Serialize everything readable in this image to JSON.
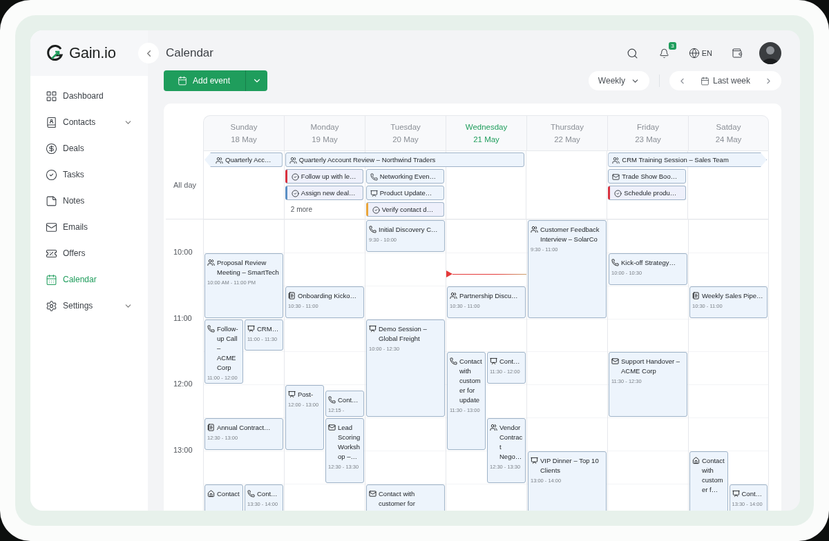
{
  "brand": {
    "name": "Gain.io"
  },
  "sidebar": {
    "items": [
      {
        "label": "Dashboard",
        "selected": false,
        "has_submenu": false
      },
      {
        "label": "Contacts",
        "selected": false,
        "has_submenu": true
      },
      {
        "label": "Deals",
        "selected": false,
        "has_submenu": false
      },
      {
        "label": "Tasks",
        "selected": false,
        "has_submenu": false
      },
      {
        "label": "Notes",
        "selected": false,
        "has_submenu": false
      },
      {
        "label": "Emails",
        "selected": false,
        "has_submenu": false
      },
      {
        "label": "Offers",
        "selected": false,
        "has_submenu": false
      },
      {
        "label": "Calendar",
        "selected": true,
        "has_submenu": false
      },
      {
        "label": "Settings",
        "selected": false,
        "has_submenu": true
      }
    ]
  },
  "header": {
    "title": "Calendar",
    "notifications": "3",
    "language": "EN"
  },
  "toolbar": {
    "add_button": "Add event",
    "view": "Weekly",
    "range": "Last week"
  },
  "calendar": {
    "all_day_label": "All day",
    "hours": [
      "10:00",
      "11:00",
      "12:00",
      "13:00"
    ],
    "days": [
      {
        "name": "Sunday",
        "date": "18 May",
        "selected": false,
        "events": [
          {
            "kind": "meeting",
            "title": "Proposal Review Meeting – SmartTech",
            "time": "10:00 AM - 11:00 PM"
          },
          {
            "kind": "call",
            "title": "Follow-up Call – ACME Corp",
            "time": "11:00 - 12:00"
          },
          {
            "kind": "presentation",
            "title": "CRM…",
            "time": "11:00 - 11:30"
          },
          {
            "kind": "note",
            "title": "Annual Contract…",
            "time": "12:30 - 13:00"
          },
          {
            "kind": "visit",
            "title": "Contact"
          },
          {
            "kind": "call",
            "title": "Cont…",
            "time": "13:30 - 14:00"
          }
        ]
      },
      {
        "name": "Monday",
        "date": "19 May",
        "selected": false,
        "events": [
          {
            "kind": "note",
            "title": "Onboarding Kicko…",
            "time": "10:30 - 11:00"
          },
          {
            "kind": "presentation",
            "title": "Post-",
            "time": "12:00 - 13:00"
          },
          {
            "kind": "call",
            "title": "Cont…",
            "time": "12:15 -"
          },
          {
            "kind": "email",
            "title": "Lead Scoring Workshop –…",
            "time": "12:30 - 13:30"
          }
        ]
      },
      {
        "name": "Tuesday",
        "date": "20 May",
        "selected": false,
        "events": [
          {
            "kind": "call",
            "title": "Initial Discovery C…",
            "time": "9:30 - 10:00"
          },
          {
            "kind": "presentation",
            "title": "Demo Session – Global Freight",
            "time": "10:00 - 12:30"
          },
          {
            "kind": "email",
            "title": "Contact with customer for"
          }
        ]
      },
      {
        "name": "Wednesday",
        "date": "21 May",
        "selected": true,
        "events": [
          {
            "kind": "meeting",
            "title": "Partnership Discu…",
            "time": "10:30 - 11:00"
          },
          {
            "kind": "call",
            "title": "Contact with customer for update",
            "time": "11:30 - 13:00"
          },
          {
            "kind": "presentation",
            "title": "Cont…",
            "time": "11:30 - 12:00"
          },
          {
            "kind": "meeting",
            "title": "Vendor Contract Nego…",
            "time": "12:30 - 13:30"
          }
        ]
      },
      {
        "name": "Thursday",
        "date": "22 May",
        "selected": false,
        "events": [
          {
            "kind": "meeting",
            "title": "Customer Feedback Interview – SolarCo",
            "time": "9:30 - 11:00"
          },
          {
            "kind": "presentation",
            "title": "VIP Dinner – Top 10 Clients",
            "time": "13:00 - 14:00"
          }
        ]
      },
      {
        "name": "Friday",
        "date": "23 May",
        "selected": false,
        "events": [
          {
            "kind": "call",
            "title": "Kick-off Strategy…",
            "time": "10:00 - 10:30"
          },
          {
            "kind": "email",
            "title": "Support Handover – ACME Corp",
            "time": "11:30 - 12:30"
          }
        ]
      },
      {
        "name": "Satday",
        "date": "24 May",
        "selected": false,
        "events": [
          {
            "kind": "note",
            "title": "Weekly Sales Pipe…",
            "time": "10:30 - 11:00"
          },
          {
            "kind": "visit",
            "title": "Contact with customer f…"
          },
          {
            "kind": "presentation",
            "title": "Cont…",
            "time": "13:30 - 14:00"
          }
        ]
      }
    ],
    "all_day": [
      {
        "kind": "meeting",
        "title": "Quarterly Acc…",
        "continues_before": true
      },
      {
        "kind": "meeting",
        "title": "Quarterly Account Review – Northwind Traders"
      },
      {
        "kind": "meeting",
        "title": "CRM Training Session – Sales Team",
        "continues_after": true
      },
      {
        "kind": "task",
        "title": "Follow up with le…",
        "color": "#d8323f"
      },
      {
        "kind": "call",
        "title": "Networking Even…"
      },
      {
        "kind": "email",
        "title": "Trade Show Boo…"
      },
      {
        "kind": "task",
        "title": "Assign new deal…",
        "color": "#5b8fc4"
      },
      {
        "kind": "presentation",
        "title": "Product Update…"
      },
      {
        "kind": "task",
        "title": "Schedule produ…",
        "color": "#d8323f"
      },
      {
        "kind": "more",
        "title": "2 more"
      },
      {
        "kind": "task",
        "title": "Verify contact d…",
        "color": "#e9a53a"
      }
    ]
  }
}
